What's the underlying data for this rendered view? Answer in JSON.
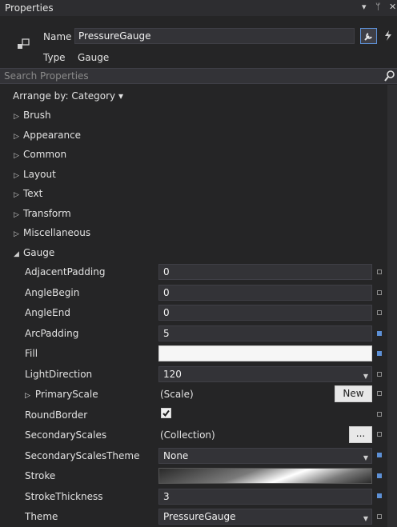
{
  "panel": {
    "title": "Properties",
    "controls": [
      "▾",
      "ᛘ",
      "✕"
    ]
  },
  "header": {
    "name_label": "Name",
    "name_value": "PressureGauge",
    "type_label": "Type",
    "type_value": "Gauge"
  },
  "search": {
    "placeholder": "Search Properties"
  },
  "arrange": {
    "label": "Arrange by: Category ▾"
  },
  "categories": [
    "Brush",
    "Appearance",
    "Common",
    "Layout",
    "Text",
    "Transform",
    "Miscellaneous",
    "Gauge"
  ],
  "props": {
    "adjacent_padding": {
      "label": "AdjacentPadding",
      "value": "0"
    },
    "angle_begin": {
      "label": "AngleBegin",
      "value": "0"
    },
    "angle_end": {
      "label": "AngleEnd",
      "value": "0"
    },
    "arc_padding": {
      "label": "ArcPadding",
      "value": "5"
    },
    "fill": {
      "label": "Fill"
    },
    "light_direction": {
      "label": "LightDirection",
      "value": "120"
    },
    "primary_scale": {
      "label": "PrimaryScale",
      "value": "(Scale)",
      "button": "New"
    },
    "round_border": {
      "label": "RoundBorder",
      "checked": true
    },
    "secondary_scales": {
      "label": "SecondaryScales",
      "value": "(Collection)",
      "button": "..."
    },
    "secondary_scales_theme": {
      "label": "SecondaryScalesTheme",
      "value": "None"
    },
    "stroke": {
      "label": "Stroke"
    },
    "stroke_thickness": {
      "label": "StrokeThickness",
      "value": "3"
    },
    "theme": {
      "label": "Theme",
      "value": "PressureGauge"
    }
  },
  "colors": {
    "background": "#252526",
    "field": "#333337",
    "accent": "#5d90d6"
  }
}
